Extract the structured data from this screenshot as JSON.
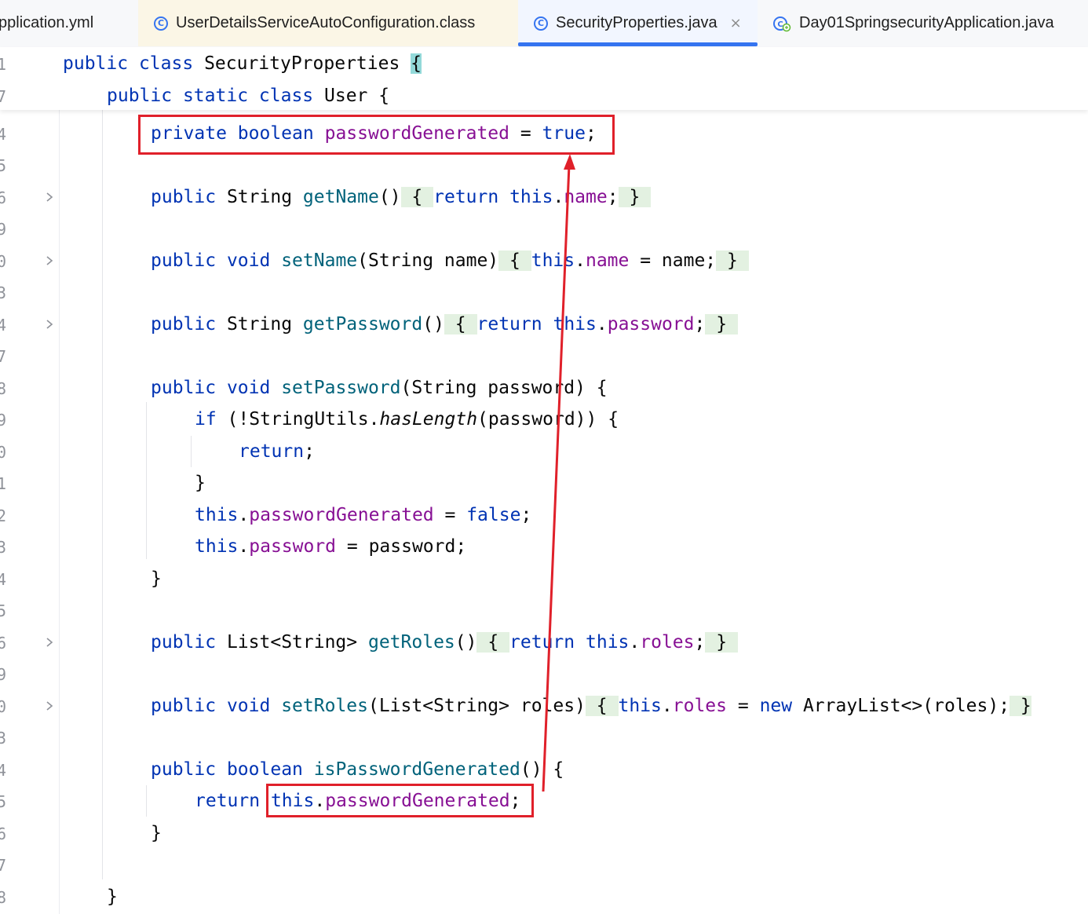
{
  "tabs": [
    {
      "label": "pplication.yml",
      "icon": "",
      "active": false
    },
    {
      "label": "UserDetailsServiceAutoConfiguration.class",
      "icon": "class-icon",
      "active": false
    },
    {
      "label": "SecurityProperties.java",
      "icon": "class-icon",
      "active": true,
      "close": "×"
    },
    {
      "label": "Day01SpringsecurityApplication.java",
      "icon": "spring-app-icon",
      "active": false
    }
  ],
  "gutter": {
    "line_numbers": [
      "1",
      "7",
      "4",
      "5",
      "6",
      "9",
      "0",
      "3",
      "4",
      "7",
      "8",
      "9",
      "0",
      "1",
      "2",
      "3",
      "4",
      "5",
      "6",
      "9",
      "0",
      "3",
      "4",
      "5",
      "6",
      "7",
      "8"
    ]
  },
  "code_lines": {
    "l1": {
      "kw1": "public",
      "kw2": "class",
      "name": "SecurityProperties",
      "brace": "{"
    },
    "l2": {
      "kw1": "public",
      "kw2": "static",
      "kw3": "class",
      "name": "User",
      "brace": "{"
    },
    "l3": {
      "kw1": "private",
      "kw2": "boolean",
      "field": "passwordGenerated",
      "eq": "=",
      "val": "true",
      "semi": ";"
    },
    "l4": {
      "kw1": "public",
      "type": "String",
      "fn": "getName",
      "parens": "()",
      "open": "{",
      "ret": "return",
      "this": "this",
      "dot": ".",
      "field": "name",
      "semi": ";",
      "close": "}"
    },
    "l5": {
      "kw1": "public",
      "kw2": "void",
      "fn": "setName",
      "args": "(String name)",
      "open": "{",
      "this": "this",
      "dot": ".",
      "field": "name",
      "rest": " = name;",
      "close": "}"
    },
    "l6": {
      "kw1": "public",
      "type": "String",
      "fn": "getPassword",
      "parens": "()",
      "open": "{",
      "ret": "return",
      "this": "this",
      "dot": ".",
      "field": "password",
      "semi": ";",
      "close": "}"
    },
    "l7": {
      "kw1": "public",
      "kw2": "void",
      "fn": "setPassword",
      "args": "(String password) {"
    },
    "l8": {
      "kw": "if",
      "a": " (!StringUtils.",
      "m": "hasLength",
      "b": "(password)) {"
    },
    "l9": {
      "kw": "return",
      "semi": ";"
    },
    "l10": {
      "text": "}"
    },
    "l11": {
      "this": "this",
      "dot": ".",
      "field": "passwordGenerated",
      "eq": " = ",
      "val": "false",
      "semi": ";"
    },
    "l12": {
      "this": "this",
      "dot": ".",
      "field": "password",
      "rest": " = password;"
    },
    "l13": {
      "text": "}"
    },
    "l14": {
      "kw1": "public",
      "type": "List<String>",
      "fn": "getRoles",
      "parens": "()",
      "open": "{",
      "ret": "return",
      "this": "this",
      "dot": ".",
      "field": "roles",
      "semi": ";",
      "close": "}"
    },
    "l15": {
      "kw1": "public",
      "kw2": "void",
      "fn": "setRoles",
      "args": "(List<String> roles)",
      "open": "{",
      "this": "this",
      "dot": ".",
      "field": "roles",
      "eq": " = ",
      "new": "new",
      "rest": " ArrayList<>(roles);",
      "close": "}"
    },
    "l16": {
      "kw1": "public",
      "kw2": "boolean",
      "fn": "isPasswordGenerated",
      "parens": "()",
      "open": " {"
    },
    "l17": {
      "ret": "return",
      "this": "this",
      "dot": ".",
      "field": "passwordGenerated",
      "semi": ";"
    },
    "l18": {
      "text": "}"
    },
    "l19": {
      "text": "}"
    }
  },
  "colors": {
    "keyword": "#0033b3",
    "method": "#00627a",
    "field": "#871094",
    "annotation": "#e0202a",
    "accent": "#3574f0"
  }
}
